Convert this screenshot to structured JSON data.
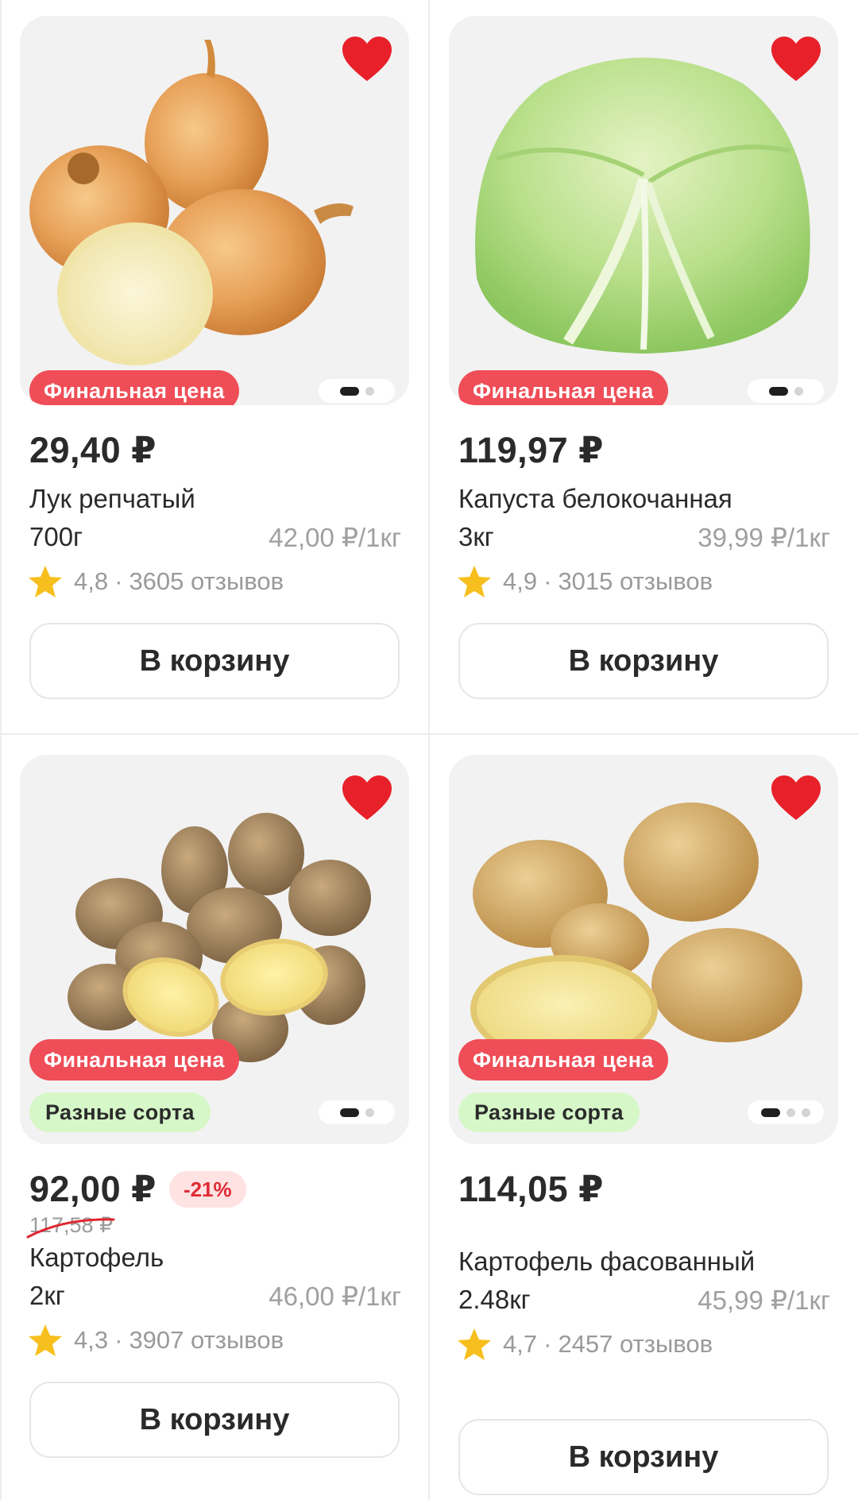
{
  "products": [
    {
      "name": "Лук репчатый",
      "price": "29,40 ₽",
      "weight": "700г",
      "unit_price": "42,00 ₽/1кг",
      "rating": "4,8",
      "reviews": "3605 отзывов",
      "badge_final": "Финальная цена",
      "button": "В корзину",
      "dots": 2,
      "active_dot": 1
    },
    {
      "name": "Капуста белокочанная",
      "price": "119,97 ₽",
      "weight": "3кг",
      "unit_price": "39,99 ₽/1кг",
      "rating": "4,9",
      "reviews": "3015 отзывов",
      "badge_final": "Финальная цена",
      "button": "В корзину",
      "dots": 2,
      "active_dot": 1
    },
    {
      "name": "Картофель",
      "price": "92,00 ₽",
      "discount": "-21%",
      "old_price": "117,58 ₽",
      "weight": "2кг",
      "unit_price": "46,00 ₽/1кг",
      "rating": "4,3",
      "reviews": "3907 отзывов",
      "badge_final": "Финальная цена",
      "badge_sort": "Разные сорта",
      "button": "В корзину",
      "dots": 2,
      "active_dot": 1
    },
    {
      "name": "Картофель фасованный",
      "price": "114,05 ₽",
      "weight": "2.48кг",
      "unit_price": "45,99 ₽/1кг",
      "rating": "4,7",
      "reviews": "2457 отзывов",
      "badge_final": "Финальная цена",
      "badge_sort": "Разные сорта",
      "button": "В корзину",
      "dots": 3,
      "active_dot": 1
    }
  ],
  "rating_separator": "·",
  "colors": {
    "badge_final_bg": "#ef4d57",
    "badge_sort_bg": "#d6f7c8",
    "discount_bg": "#ffe2e2",
    "discount_text": "#e02b35",
    "heart": "#e8202a",
    "star": "#f7bf1e"
  },
  "icons": {
    "favorite": "heart-icon",
    "rating": "star-icon"
  }
}
